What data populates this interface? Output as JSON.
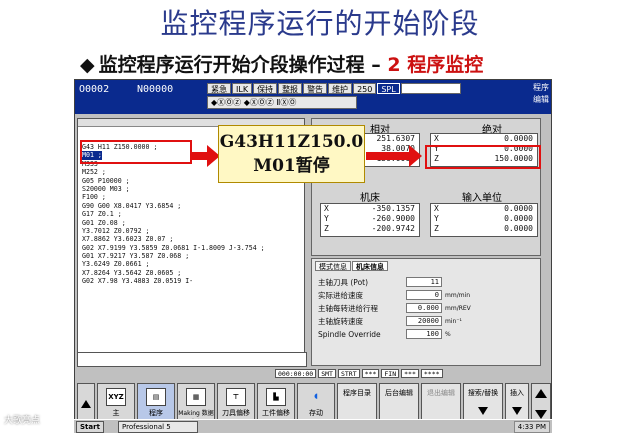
{
  "slide": {
    "title": "监控程序运行的开始阶段",
    "subtitle_bullet": "◆",
    "subtitle_main": "监控程序运行开始介段操作过程 –",
    "subtitle_highlight": "2 程序监控"
  },
  "cnc": {
    "program_no": "O0002",
    "sequence_no": "N00000",
    "status_cells": [
      "紧急",
      "ILK",
      "保持",
      "整报",
      "警告",
      "维护",
      "250",
      "SPL"
    ],
    "icon_row_text": "◆ⓍⓄⓏ  ◆ⓍⓄⓏ  ⅡⓍⓄ",
    "caption_1": "程序",
    "caption_2": "编辑",
    "code_lines": [
      "G43 H11 Z150.0000 ;",
      "M01 ;",
      "M333",
      "M252 ;",
      "G05 P10000 ;",
      "S20000 M03 ;",
      "F100 ;",
      "G90 G00 X8.0417 Y3.6854 ;",
      "G17 Z0.1 ;",
      "G01 Z0.08 ;",
      "Y3.7012 Z0.0792 ;",
      "X7.8862 Y3.6023 Z0.07 ;",
      "G02 X7.9199 Y3.5859 Z0.0681 I-1.8009 J-3.754 ;",
      "G01 X7.9217 Y3.587 Z0.068 ;",
      "Y3.6249 Z0.0661 ;",
      "X7.8264 Y3.5642 Z0.0605 ;",
      "G02 X7.98 Y3.4883 Z0.0519 I-"
    ],
    "coord_relative": {
      "title": "相对",
      "values": [
        "251.6307",
        "38.0070",
        "150.0000"
      ]
    },
    "coord_absolute": {
      "title": "绝对",
      "axes": [
        "X",
        "Y",
        "Z"
      ],
      "values": [
        "0.0000",
        "0.0000",
        "150.0000"
      ]
    },
    "coord_machine": {
      "title": "机床",
      "axes": [
        "X",
        "Y",
        "Z"
      ],
      "values": [
        "-350.1357",
        "-260.9000",
        "-200.9742"
      ]
    },
    "coord_input": {
      "title": "输入单位",
      "axes": [
        "X",
        "Y",
        "Z"
      ],
      "values": [
        "0.0000",
        "0.0000",
        "0.0000"
      ]
    },
    "info_tabs": [
      "模式信息",
      "机床信息"
    ],
    "info_rows": [
      {
        "label": "主轴刀具 (Pot)",
        "value": "11",
        "unit": ""
      },
      {
        "label": "实际进给速度",
        "value": "0",
        "unit": "mm/min"
      },
      {
        "label": "主轴每转进给行程",
        "value": "0.000",
        "unit": "mm/REV"
      },
      {
        "label": "主轴旋转速度",
        "value": "20000",
        "unit": "min⁻¹"
      },
      {
        "label": "Spindle Override",
        "value": "100",
        "unit": "%"
      }
    ],
    "status_fields": [
      "000:00:00",
      "SMT",
      "STRT",
      "***",
      "FIN",
      "***",
      "****"
    ],
    "softkeys": {
      "main": "主",
      "main_icon": "XYZ",
      "program": "程序",
      "making": "Making 数据中心",
      "tool": "刀具偏移",
      "work": "工件偏移",
      "start": "存动",
      "prog_list": "程序目录",
      "bg_edit": "后台编辑",
      "exit_edit": "退出编辑",
      "search": "搜索/替换",
      "insert": "插入"
    },
    "taskbar": {
      "start": "Start",
      "app": "Professional 5",
      "time": "4:33 PM"
    }
  },
  "callout": {
    "line1": "G43H11Z150.0",
    "line2": "M01暂停"
  },
  "watermark": "大歌亮点",
  "colors": {
    "title": "#2a3a8c",
    "highlight": "#cc1111",
    "cnc_header": "#0a2a8e",
    "callout_bg": "#fff8c4",
    "callout_arrow": "#e01010"
  }
}
